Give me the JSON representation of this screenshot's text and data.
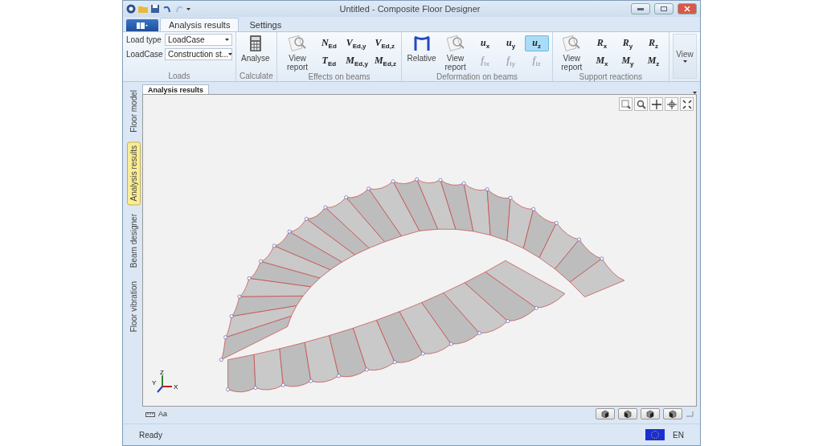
{
  "window": {
    "title": "Untitled - Composite Floor Designer"
  },
  "ribbon_tabs": [
    {
      "label": "Analysis results",
      "selected": true
    },
    {
      "label": "Settings",
      "selected": false
    }
  ],
  "ribbon_groups": [
    {
      "kind": "loads",
      "label": "Loads",
      "fields": [
        {
          "label": "Load type",
          "value": "LoadCase"
        },
        {
          "label": "LoadCase",
          "value": "Construction st..."
        }
      ]
    },
    {
      "kind": "buttons",
      "label": "Calculate",
      "large": [
        {
          "kind": "analyse",
          "label": "Analyse"
        }
      ]
    },
    {
      "kind": "buttons",
      "label": "Effects on beams",
      "large": [
        {
          "kind": "report",
          "label": "View report"
        }
      ],
      "symbols": [
        {
          "text": "N$_{Ed}$",
          "selected": false,
          "disabled": false
        },
        {
          "text": "V$_{Ed,y}$",
          "selected": false,
          "disabled": false
        },
        {
          "text": "V$_{Ed,z}$",
          "selected": false,
          "disabled": false
        },
        {
          "text": "T$_{Ed}$",
          "selected": false,
          "disabled": false
        },
        {
          "text": "M$_{Ed,y}$",
          "selected": false,
          "disabled": false
        },
        {
          "text": "M$_{Ed,z}$",
          "selected": false,
          "disabled": false
        }
      ]
    },
    {
      "kind": "buttons",
      "label": "Deformation on beams",
      "large": [
        {
          "kind": "relative",
          "label": "Relative"
        },
        {
          "kind": "report",
          "label": "View report"
        }
      ],
      "symbols": [
        {
          "text": "u$_{x}$",
          "selected": false,
          "disabled": false
        },
        {
          "text": "u$_{y}$",
          "selected": false,
          "disabled": false
        },
        {
          "text": "u$_{z}$",
          "selected": true,
          "disabled": false
        },
        {
          "text": "f$_{lx}$",
          "selected": false,
          "disabled": true
        },
        {
          "text": "f$_{ly}$",
          "selected": false,
          "disabled": true
        },
        {
          "text": "f$_{lz}$",
          "selected": false,
          "disabled": true
        }
      ]
    },
    {
      "kind": "buttons",
      "label": "Support reactions",
      "large": [
        {
          "kind": "report",
          "label": "View report"
        }
      ],
      "symbols": [
        {
          "text": "R$_{x}$",
          "selected": false,
          "disabled": false
        },
        {
          "text": "R$_{y}$",
          "selected": false,
          "disabled": false
        },
        {
          "text": "R$_{z}$",
          "selected": false,
          "disabled": false
        },
        {
          "text": "M$_{x}$",
          "selected": false,
          "disabled": false
        },
        {
          "text": "M$_{y}$",
          "selected": false,
          "disabled": false
        },
        {
          "text": "M$_{z}$",
          "selected": false,
          "disabled": false
        }
      ]
    },
    {
      "kind": "view",
      "label": "View"
    }
  ],
  "side_tabs": [
    {
      "label": "Floor model",
      "selected": false
    },
    {
      "label": "Analysis results",
      "selected": true
    },
    {
      "label": "Beam designer",
      "selected": false
    },
    {
      "label": "Floor vibration",
      "selected": false
    }
  ],
  "document_tab": {
    "label": "Analysis results"
  },
  "axis_labels": [
    "Z",
    "Y",
    "X"
  ],
  "bottom_bar": {
    "font_label": "Aa"
  },
  "status_bar": {
    "text": "Ready",
    "language": "EN"
  }
}
